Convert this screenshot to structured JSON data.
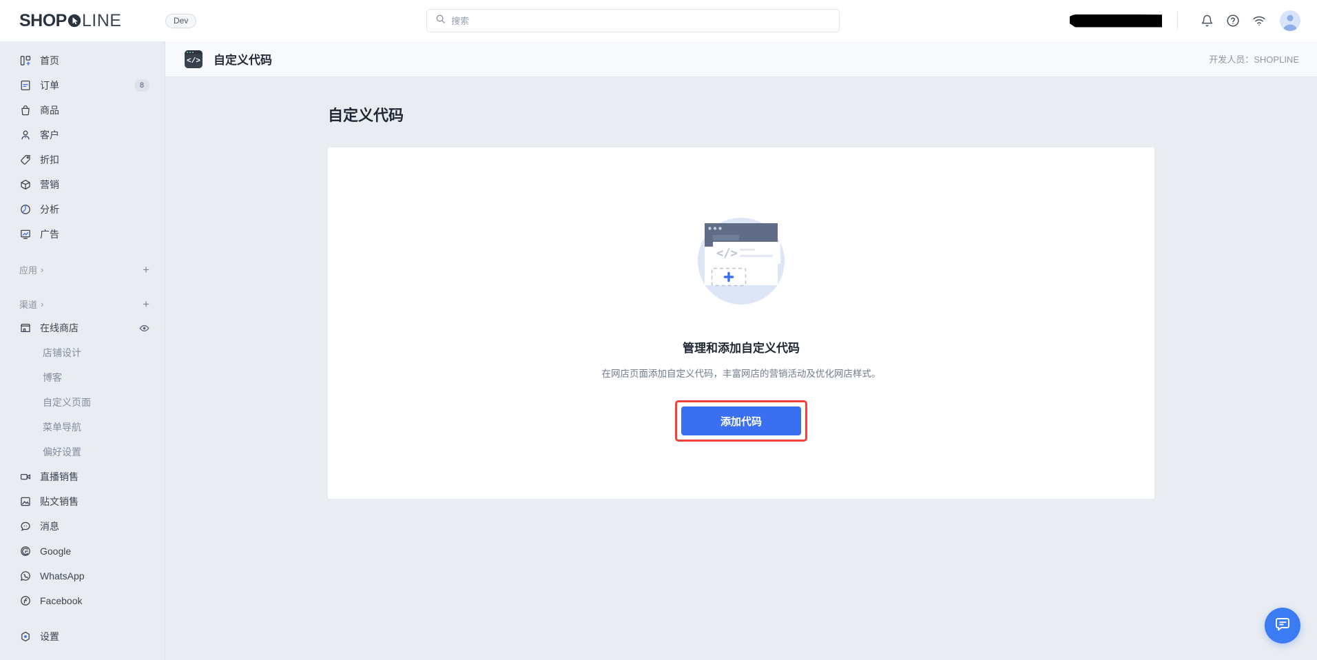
{
  "brand": {
    "logo_bold": "SHOP",
    "logo_light": "LINE",
    "dev_badge": "Dev"
  },
  "search": {
    "placeholder": "搜索",
    "value": "",
    "icon": "search-icon"
  },
  "topbar": {
    "icons": [
      "bell-icon",
      "help-circle-icon",
      "wifi-icon",
      "avatar-icon"
    ],
    "store_name_redacted": ""
  },
  "sidebar": {
    "items": [
      {
        "label": "首页",
        "icon": "dashboard-icon",
        "badge": ""
      },
      {
        "label": "订单",
        "icon": "order-icon",
        "badge": "8"
      },
      {
        "label": "商品",
        "icon": "bag-icon",
        "badge": ""
      },
      {
        "label": "客户",
        "icon": "user-icon",
        "badge": ""
      },
      {
        "label": "折扣",
        "icon": "tag-icon",
        "badge": ""
      },
      {
        "label": "营销",
        "icon": "cube-icon",
        "badge": ""
      },
      {
        "label": "分析",
        "icon": "pie-chart-icon",
        "badge": ""
      },
      {
        "label": "广告",
        "icon": "megaphone-screen-icon",
        "badge": ""
      }
    ],
    "groups": [
      {
        "label": "应用",
        "chevron": "›",
        "add": "+"
      },
      {
        "label": "渠道",
        "chevron": "›",
        "add": "+"
      }
    ],
    "online_store": {
      "label": "在线商店",
      "icon": "storefront-icon",
      "eye": "eye-icon"
    },
    "sub_items": [
      {
        "label": "店铺设计"
      },
      {
        "label": "博客"
      },
      {
        "label": "自定义页面"
      },
      {
        "label": "菜单导航"
      },
      {
        "label": "偏好设置"
      }
    ],
    "channel_items": [
      {
        "label": "直播销售",
        "icon": "video-icon"
      },
      {
        "label": "贴文销售",
        "icon": "image-icon"
      },
      {
        "label": "消息",
        "icon": "chat-bubble-icon"
      },
      {
        "label": "Google",
        "icon": "google-icon"
      },
      {
        "label": "WhatsApp",
        "icon": "whatsapp-icon"
      },
      {
        "label": "Facebook",
        "icon": "facebook-icon"
      }
    ],
    "settings": {
      "label": "设置",
      "icon": "gear-icon"
    }
  },
  "page_header": {
    "app_icon": "code-window-icon",
    "title": "自定义代码",
    "developer_label": "开发人员：SHOPLINE"
  },
  "main": {
    "page_title": "自定义代码",
    "empty_state": {
      "illustration": "code-window-add-illustration",
      "title": "管理和添加自定义代码",
      "description": "在网店页面添加自定义代码，丰富网店的营销活动及优化网店样式。",
      "cta_label": "添加代码",
      "cta_highlighted": true
    }
  },
  "fab": {
    "icon": "chat-icon"
  },
  "colors": {
    "accent": "#3b6ff2",
    "highlight": "#f5413a",
    "page_bg": "#e9ecf1",
    "card_bg": "#ffffff",
    "text_primary": "#1f2734",
    "text_muted": "#848ea0"
  }
}
